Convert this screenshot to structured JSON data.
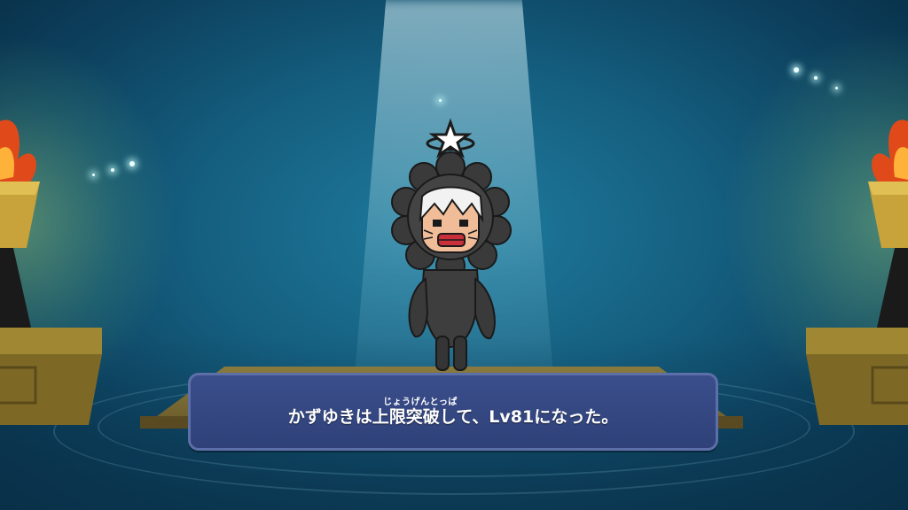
{
  "message": {
    "ruby": "じょうげんとっぱ",
    "text": "かずゆきは上限突破して、Lv81になった。"
  },
  "character": {
    "name": "かずゆき",
    "level": 81,
    "costume": "black-lion-suit"
  },
  "colors": {
    "background": "#155f80",
    "dialog": "#3a4e8c",
    "dialog_border": "#5d6fa8",
    "stage": "#8a7a3e"
  },
  "icons": {
    "halo_star": "star-icon",
    "torch": "torch-icon"
  }
}
